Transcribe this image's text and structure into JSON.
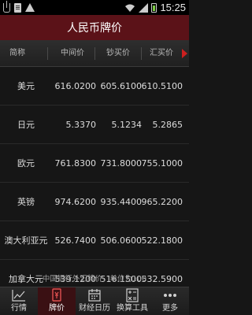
{
  "status_bar": {
    "time": "15:25",
    "icons": [
      "usb-icon",
      "file-icon",
      "warning-icon",
      "wifi-icon",
      "signal-icon",
      "battery-icon"
    ]
  },
  "title": "人民币牌价",
  "columns": {
    "name": "简称",
    "mid": "中间价",
    "buy": "钞买价",
    "sell": "汇买价"
  },
  "rows": [
    {
      "name": "美元",
      "mid": "616.0200",
      "buy": "605.6100",
      "sell": "610.5100"
    },
    {
      "name": "日元",
      "mid": "5.3370",
      "buy": "5.1234",
      "sell": "5.2865"
    },
    {
      "name": "欧元",
      "mid": "761.8300",
      "buy": "731.8000",
      "sell": "755.1000"
    },
    {
      "name": "英镑",
      "mid": "974.6200",
      "buy": "935.4400",
      "sell": "965.2200"
    },
    {
      "name": "澳大利亚元",
      "mid": "526.7400",
      "buy": "506.0600",
      "sell": "522.1800"
    },
    {
      "name": "加拿大元",
      "mid": "539.1200",
      "buy": "516.1500",
      "sell": "532.5900"
    }
  ],
  "footer_note": "中国银行外汇牌价，单位为100",
  "nav": [
    {
      "label": "行情",
      "icon": "chart-icon",
      "active": false
    },
    {
      "label": "牌价",
      "icon": "price-tag-icon",
      "active": true
    },
    {
      "label": "财经日历",
      "icon": "calendar-icon",
      "active": false
    },
    {
      "label": "换算工具",
      "icon": "calculator-icon",
      "active": false
    },
    {
      "label": "更多",
      "icon": "more-icon",
      "active": false
    }
  ],
  "colors": {
    "title_bar": "#5b1218",
    "accent_arrow": "#cc1f1f",
    "background": "#161616"
  }
}
